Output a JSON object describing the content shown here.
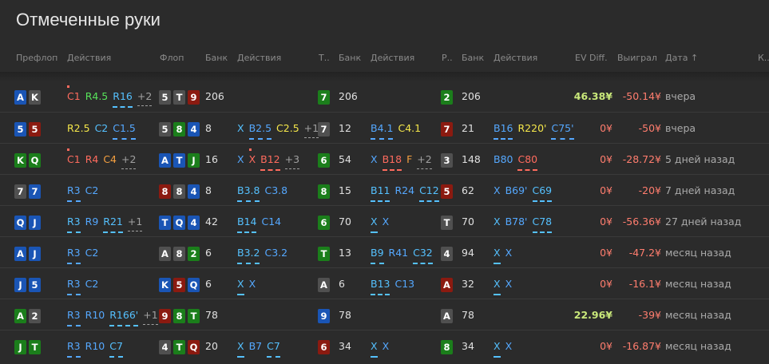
{
  "title": "Отмеченные руки",
  "headers": {
    "preflop": "Префлоп",
    "actions1": "Действия",
    "flop": "Флоп",
    "bank1": "Банк",
    "actions2": "Действия",
    "turn": "Т..",
    "bank2": "Банк",
    "actions3": "Действия",
    "river": "Р..",
    "bank3": "Банк",
    "actions4": "Действия",
    "ev": "EV Diff.",
    "won": "Выиграл",
    "date": "Дата ↑",
    "k": "К.."
  },
  "colors": {
    "spades": "#505050",
    "hearts": "#8b1a10",
    "diamonds": "#1a55b5",
    "clubs": "#1b7e1b"
  },
  "rows": [
    {
      "hand": [
        [
          "A",
          "d"
        ],
        [
          "K",
          "s"
        ]
      ],
      "pre": [
        {
          "t": "C1",
          "c": "cRed",
          "u": false,
          "dot": true
        },
        {
          "t": "R4.5",
          "c": "cGreen",
          "u": false
        },
        {
          "t": "R16",
          "c": "cC",
          "u": true
        },
        {
          "t": "+2",
          "c": "more"
        }
      ],
      "flop": [
        [
          "5",
          "s"
        ],
        [
          "T",
          "s"
        ],
        [
          "9",
          "h"
        ]
      ],
      "fbank": "206",
      "fact": [],
      "turn": [
        "7",
        "c"
      ],
      "tbank": "206",
      "tact": [],
      "river": [
        "2",
        "c"
      ],
      "rbank": "206",
      "ract": [],
      "ev": "46.38¥",
      "evc": "ev",
      "won": "-50.14¥",
      "date": "вчера"
    },
    {
      "hand": [
        [
          "5",
          "d"
        ],
        [
          "5",
          "h"
        ]
      ],
      "pre": [
        {
          "t": "R2.5",
          "c": "cYellow",
          "u": false
        },
        {
          "t": "C2",
          "c": "cC",
          "u": false
        },
        {
          "t": "C1.5",
          "c": "cB",
          "u": true
        }
      ],
      "flop": [
        [
          "5",
          "s"
        ],
        [
          "8",
          "c"
        ],
        [
          "4",
          "d"
        ]
      ],
      "fbank": "8",
      "fact": [
        {
          "t": "X",
          "c": "cX",
          "u": false
        },
        {
          "t": "B2.5",
          "c": "cB",
          "u": true
        },
        {
          "t": "C2.5",
          "c": "cYellow",
          "u": false
        },
        {
          "t": "+1",
          "c": "more"
        }
      ],
      "turn": [
        "7",
        "s"
      ],
      "tbank": "12",
      "tact": [
        {
          "t": "B4.1",
          "c": "cB",
          "u": true
        },
        {
          "t": "C4.1",
          "c": "cYellow",
          "u": false
        }
      ],
      "river": [
        "7",
        "h"
      ],
      "rbank": "21",
      "ract": [
        {
          "t": "B16",
          "c": "cB",
          "u": true
        },
        {
          "t": "R220'",
          "c": "cYellow",
          "u": false
        },
        {
          "t": "C75'",
          "c": "cB",
          "u": true
        }
      ],
      "ev": "0¥",
      "evc": "zero",
      "won": "-50¥",
      "date": "вчера"
    },
    {
      "hand": [
        [
          "K",
          "c"
        ],
        [
          "Q",
          "c"
        ]
      ],
      "pre": [
        {
          "t": "C1",
          "c": "cRed",
          "u": false,
          "dot": true
        },
        {
          "t": "R4",
          "c": "cRed",
          "u": false
        },
        {
          "t": "C4",
          "c": "cOrange",
          "u": false
        },
        {
          "t": "+2",
          "c": "more"
        }
      ],
      "flop": [
        [
          "A",
          "d"
        ],
        [
          "T",
          "d"
        ],
        [
          "J",
          "c"
        ]
      ],
      "fbank": "16",
      "fact": [
        {
          "t": "X",
          "c": "cB",
          "u": false
        },
        {
          "t": "X",
          "c": "cRed",
          "u": false,
          "dot": true
        },
        {
          "t": "B12",
          "c": "cRed",
          "u": true
        },
        {
          "t": "+3",
          "c": "more"
        }
      ],
      "turn": [
        "6",
        "c"
      ],
      "tbank": "54",
      "tact": [
        {
          "t": "X",
          "c": "cB",
          "u": false
        },
        {
          "t": "B18",
          "c": "cRed",
          "u": true
        },
        {
          "t": "F",
          "c": "cOrange",
          "u": false
        },
        {
          "t": "+2",
          "c": "more"
        }
      ],
      "river": [
        "3",
        "s"
      ],
      "rbank": "148",
      "ract": [
        {
          "t": "B80",
          "c": "cB",
          "u": false
        },
        {
          "t": "C80",
          "c": "cRed",
          "u": true
        }
      ],
      "ev": "0¥",
      "evc": "zero",
      "won": "-28.72¥",
      "date": "5 дней назад"
    },
    {
      "hand": [
        [
          "7",
          "s"
        ],
        [
          "7",
          "d"
        ]
      ],
      "pre": [
        {
          "t": "R3",
          "c": "cB",
          "u": true
        },
        {
          "t": "C2",
          "c": "cB",
          "u": false
        }
      ],
      "flop": [
        [
          "8",
          "h"
        ],
        [
          "8",
          "s"
        ],
        [
          "4",
          "d"
        ]
      ],
      "fbank": "8",
      "fact": [
        {
          "t": "B3.8",
          "c": "cC",
          "u": true
        },
        {
          "t": "C3.8",
          "c": "cB",
          "u": false
        }
      ],
      "turn": [
        "8",
        "c"
      ],
      "tbank": "15",
      "tact": [
        {
          "t": "B11",
          "c": "cC",
          "u": true
        },
        {
          "t": "R24",
          "c": "cB",
          "u": false
        },
        {
          "t": "C12",
          "c": "cC",
          "u": true
        }
      ],
      "river": [
        "5",
        "h"
      ],
      "rbank": "62",
      "ract": [
        {
          "t": "X",
          "c": "cB",
          "u": false
        },
        {
          "t": "B69'",
          "c": "cB",
          "u": false
        },
        {
          "t": "C69",
          "c": "cC",
          "u": true
        }
      ],
      "ev": "0¥",
      "evc": "zero",
      "won": "-20¥",
      "date": "7 дней назад"
    },
    {
      "hand": [
        [
          "Q",
          "d"
        ],
        [
          "J",
          "d"
        ]
      ],
      "pre": [
        {
          "t": "R3",
          "c": "cC",
          "u": true
        },
        {
          "t": "R9",
          "c": "cB",
          "u": false
        },
        {
          "t": "R21",
          "c": "cC",
          "u": true
        },
        {
          "t": "+1",
          "c": "more"
        }
      ],
      "flop": [
        [
          "T",
          "d"
        ],
        [
          "Q",
          "d"
        ],
        [
          "4",
          "d"
        ]
      ],
      "fbank": "42",
      "fact": [
        {
          "t": "B14",
          "c": "cC",
          "u": true
        },
        {
          "t": "C14",
          "c": "cB",
          "u": false
        }
      ],
      "turn": [
        "6",
        "c"
      ],
      "tbank": "70",
      "tact": [
        {
          "t": "X",
          "c": "cC",
          "u": true
        },
        {
          "t": "X",
          "c": "cB",
          "u": false
        }
      ],
      "river": [
        "T",
        "s"
      ],
      "rbank": "70",
      "ract": [
        {
          "t": "X",
          "c": "cC",
          "u": false
        },
        {
          "t": "B78'",
          "c": "cB",
          "u": false
        },
        {
          "t": "C78",
          "c": "cC",
          "u": true
        }
      ],
      "ev": "0¥",
      "evc": "zero",
      "won": "-56.36¥",
      "date": "27 дней назад"
    },
    {
      "hand": [
        [
          "A",
          "d"
        ],
        [
          "J",
          "d"
        ]
      ],
      "pre": [
        {
          "t": "R3",
          "c": "cB",
          "u": true
        },
        {
          "t": "C2",
          "c": "cB",
          "u": false
        }
      ],
      "flop": [
        [
          "A",
          "s"
        ],
        [
          "8",
          "s"
        ],
        [
          "2",
          "c"
        ]
      ],
      "fbank": "6",
      "fact": [
        {
          "t": "B3.2",
          "c": "cC",
          "u": true
        },
        {
          "t": "C3.2",
          "c": "cB",
          "u": false
        }
      ],
      "turn": [
        "T",
        "c"
      ],
      "tbank": "13",
      "tact": [
        {
          "t": "B9",
          "c": "cC",
          "u": true
        },
        {
          "t": "R41",
          "c": "cB",
          "u": false
        },
        {
          "t": "C32",
          "c": "cC",
          "u": true
        }
      ],
      "river": [
        "4",
        "s"
      ],
      "rbank": "94",
      "ract": [
        {
          "t": "X",
          "c": "cC",
          "u": true
        },
        {
          "t": "X",
          "c": "cB",
          "u": false
        }
      ],
      "ev": "0¥",
      "evc": "zero",
      "won": "-47.2¥",
      "date": "месяц назад"
    },
    {
      "hand": [
        [
          "J",
          "d"
        ],
        [
          "5",
          "d"
        ]
      ],
      "pre": [
        {
          "t": "R3",
          "c": "cB",
          "u": true
        },
        {
          "t": "C2",
          "c": "cB",
          "u": false
        }
      ],
      "flop": [
        [
          "K",
          "d"
        ],
        [
          "5",
          "h"
        ],
        [
          "Q",
          "d"
        ]
      ],
      "fbank": "6",
      "fact": [
        {
          "t": "X",
          "c": "cC",
          "u": true
        },
        {
          "t": "X",
          "c": "cB",
          "u": false
        }
      ],
      "turn": [
        "A",
        "s"
      ],
      "tbank": "6",
      "tact": [
        {
          "t": "B13",
          "c": "cC",
          "u": true
        },
        {
          "t": "C13",
          "c": "cB",
          "u": false
        }
      ],
      "river": [
        "A",
        "h"
      ],
      "rbank": "32",
      "ract": [
        {
          "t": "X",
          "c": "cC",
          "u": true
        },
        {
          "t": "X",
          "c": "cB",
          "u": false
        }
      ],
      "ev": "0¥",
      "evc": "zero",
      "won": "-16.1¥",
      "date": "месяц назад"
    },
    {
      "hand": [
        [
          "A",
          "c"
        ],
        [
          "2",
          "s"
        ]
      ],
      "pre": [
        {
          "t": "R3",
          "c": "cB",
          "u": true
        },
        {
          "t": "R10",
          "c": "cB",
          "u": false
        },
        {
          "t": "R166'",
          "c": "cC",
          "u": true
        },
        {
          "t": "+1",
          "c": "more"
        }
      ],
      "flop": [
        [
          "9",
          "h"
        ],
        [
          "8",
          "c"
        ],
        [
          "T",
          "c"
        ]
      ],
      "fbank": "78",
      "fact": [],
      "turn": [
        "9",
        "d"
      ],
      "tbank": "78",
      "tact": [],
      "river": [
        "A",
        "s"
      ],
      "rbank": "78",
      "ract": [],
      "ev": "22.96¥",
      "evc": "ev",
      "won": "-39¥",
      "date": "месяц назад"
    },
    {
      "hand": [
        [
          "J",
          "c"
        ],
        [
          "T",
          "c"
        ]
      ],
      "pre": [
        {
          "t": "R3",
          "c": "cB",
          "u": true
        },
        {
          "t": "R10",
          "c": "cB",
          "u": false
        },
        {
          "t": "C7",
          "c": "cC",
          "u": true
        }
      ],
      "flop": [
        [
          "4",
          "s"
        ],
        [
          "T",
          "c"
        ],
        [
          "Q",
          "h"
        ]
      ],
      "fbank": "20",
      "fact": [
        {
          "t": "X",
          "c": "cC",
          "u": true
        },
        {
          "t": "B7",
          "c": "cB",
          "u": false
        },
        {
          "t": "C7",
          "c": "cC",
          "u": true
        }
      ],
      "turn": [
        "6",
        "h"
      ],
      "tbank": "34",
      "tact": [
        {
          "t": "X",
          "c": "cC",
          "u": true
        },
        {
          "t": "X",
          "c": "cB",
          "u": false
        }
      ],
      "river": [
        "8",
        "c"
      ],
      "rbank": "34",
      "ract": [
        {
          "t": "X",
          "c": "cC",
          "u": true
        },
        {
          "t": "X",
          "c": "cB",
          "u": false
        }
      ],
      "ev": "0¥",
      "evc": "zero",
      "won": "-16.87¥",
      "date": "месяц назад"
    }
  ]
}
